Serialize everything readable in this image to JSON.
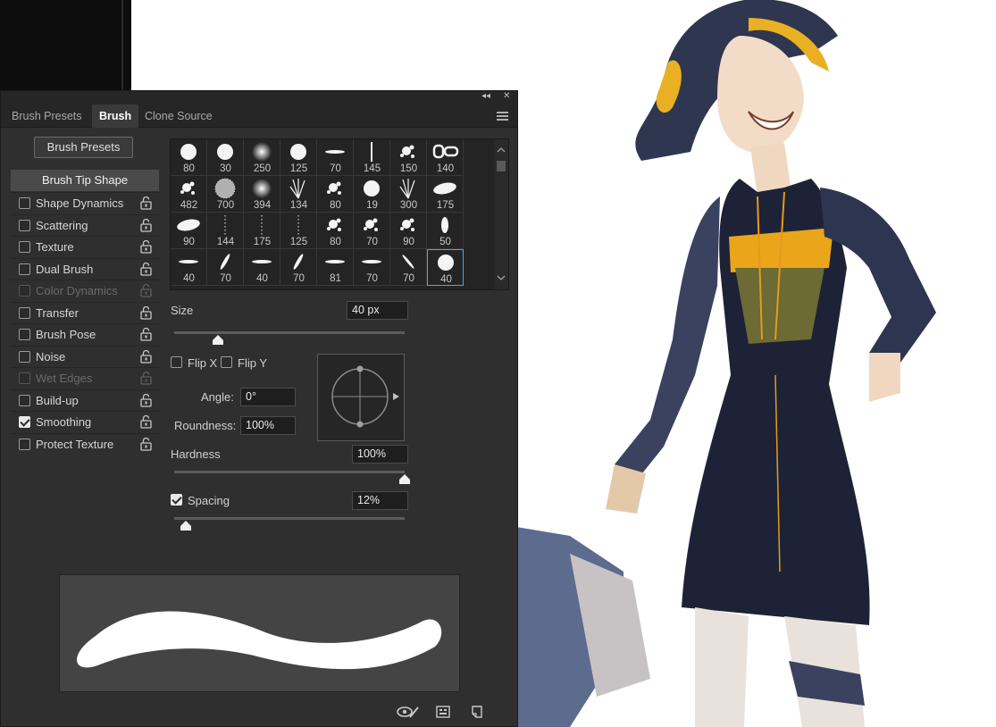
{
  "window": {
    "collapse_glyph": "◂◂",
    "close_glyph": "✕"
  },
  "tabs": [
    {
      "label": "Brush Presets",
      "active": false
    },
    {
      "label": "Brush",
      "active": true
    },
    {
      "label": "Clone Source",
      "active": false
    }
  ],
  "presets_button": "Brush Presets",
  "tip_shape_label": "Brush Tip Shape",
  "options": [
    {
      "label": "Shape Dynamics",
      "checked": false,
      "enabled": true
    },
    {
      "label": "Scattering",
      "checked": false,
      "enabled": true
    },
    {
      "label": "Texture",
      "checked": false,
      "enabled": true
    },
    {
      "label": "Dual Brush",
      "checked": false,
      "enabled": true
    },
    {
      "label": "Color Dynamics",
      "checked": false,
      "enabled": false
    },
    {
      "label": "Transfer",
      "checked": false,
      "enabled": true
    },
    {
      "label": "Brush Pose",
      "checked": false,
      "enabled": true
    },
    {
      "label": "Noise",
      "checked": false,
      "enabled": true
    },
    {
      "label": "Wet Edges",
      "checked": false,
      "enabled": false
    },
    {
      "label": "Build-up",
      "checked": false,
      "enabled": true
    },
    {
      "label": "Smoothing",
      "checked": true,
      "enabled": true
    },
    {
      "label": "Protect Texture",
      "checked": false,
      "enabled": true
    }
  ],
  "brush_sizes": [
    [
      "80",
      "30",
      "250",
      "125",
      "70",
      "145",
      "150",
      "140"
    ],
    [
      "482",
      "700",
      "394",
      "134",
      "80",
      "19",
      "300",
      "175"
    ],
    [
      "90",
      "144",
      "175",
      "125",
      "80",
      "70",
      "90",
      "50"
    ],
    [
      "40",
      "70",
      "40",
      "70",
      "81",
      "70",
      "70",
      "40"
    ]
  ],
  "brush_kinds": [
    [
      "hard",
      "hard",
      "soft",
      "hard",
      "flat",
      "vertical",
      "splat",
      "chain"
    ],
    [
      "splat",
      "texture",
      "soft",
      "grass",
      "splat",
      "hard",
      "grass",
      "leaf"
    ],
    [
      "leaf",
      "dots",
      "dots",
      "dots",
      "splat",
      "splat",
      "splat",
      "oval"
    ],
    [
      "flat",
      "diag",
      "flat",
      "diag",
      "flat",
      "flat",
      "diag2",
      "hard"
    ]
  ],
  "selected_brush": {
    "row": 3,
    "col": 7
  },
  "size": {
    "label": "Size",
    "value": "40 px",
    "slider_fraction": 0.19
  },
  "flip_x": {
    "label": "Flip X",
    "checked": false
  },
  "flip_y": {
    "label": "Flip Y",
    "checked": false
  },
  "angle": {
    "label": "Angle:",
    "value": "0°"
  },
  "roundness": {
    "label": "Roundness:",
    "value": "100%"
  },
  "hardness": {
    "label": "Hardness",
    "value": "100%",
    "slider_fraction": 1.0
  },
  "spacing": {
    "label": "Spacing",
    "value": "12%",
    "checked": true,
    "slider_fraction": 0.05
  },
  "colors": {
    "panel": "#2f2f2f",
    "accent": "#4da3e8",
    "text": "#d6d6d6"
  },
  "bottom_icons": [
    "eye-brush-icon",
    "brush-grid-icon",
    "new-preset-icon"
  ]
}
